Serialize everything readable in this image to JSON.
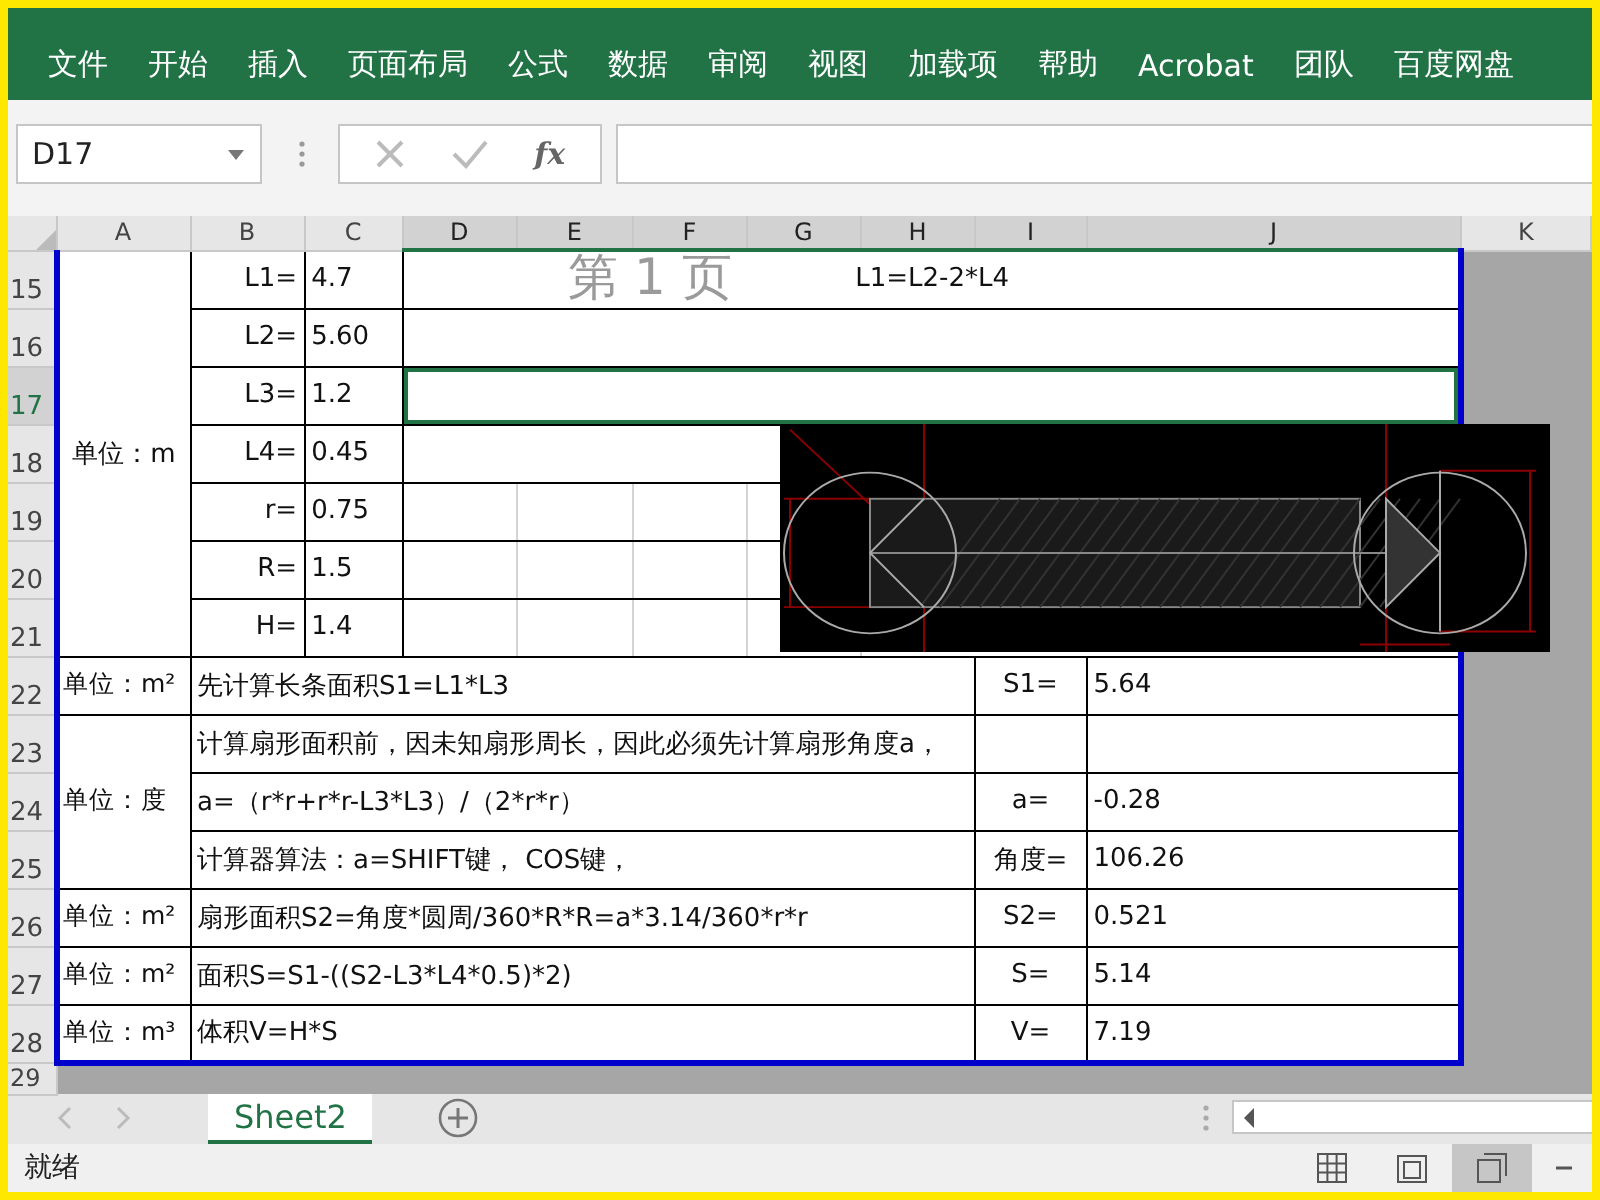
{
  "ribbon": {
    "tabs": [
      "文件",
      "开始",
      "插入",
      "页面布局",
      "公式",
      "数据",
      "审阅",
      "视图",
      "加载项",
      "帮助",
      "Acrobat",
      "团队",
      "百度网盘"
    ]
  },
  "formula_bar": {
    "name_box": "D17",
    "function_label": "fx"
  },
  "sheet": {
    "columns": [
      {
        "label": "A",
        "selected": false
      },
      {
        "label": "B",
        "selected": false
      },
      {
        "label": "C",
        "selected": false
      },
      {
        "label": "D",
        "selected": true
      },
      {
        "label": "E",
        "selected": true
      },
      {
        "label": "F",
        "selected": true
      },
      {
        "label": "G",
        "selected": true
      },
      {
        "label": "H",
        "selected": true
      },
      {
        "label": "I",
        "selected": true
      },
      {
        "label": "J",
        "selected": true
      },
      {
        "label": "K",
        "selected": false
      }
    ],
    "rows": [
      {
        "label": "15",
        "selected": false
      },
      {
        "label": "16",
        "selected": false
      },
      {
        "label": "17",
        "selected": true
      },
      {
        "label": "18",
        "selected": false
      },
      {
        "label": "19",
        "selected": false
      },
      {
        "label": "20",
        "selected": false
      },
      {
        "label": "21",
        "selected": false
      },
      {
        "label": "22",
        "selected": false
      },
      {
        "label": "23",
        "selected": false
      },
      {
        "label": "24",
        "selected": false
      },
      {
        "label": "25",
        "selected": false
      },
      {
        "label": "26",
        "selected": false
      },
      {
        "label": "27",
        "selected": false
      },
      {
        "label": "28",
        "selected": false
      },
      {
        "label": "29",
        "selected": false
      }
    ],
    "page_label": "第 1 页",
    "input_block": {
      "unit": "单位：m",
      "note": "L1=L2-2*L4",
      "params": [
        {
          "name": "L1=",
          "value": "4.7"
        },
        {
          "name": "L2=",
          "value": "5.60"
        },
        {
          "name": "L3=",
          "value": "1.2"
        },
        {
          "name": "L4=",
          "value": "0.45"
        },
        {
          "name": "r=",
          "value": "0.75"
        },
        {
          "name": "R=",
          "value": "1.5"
        },
        {
          "name": "H=",
          "value": "1.4"
        }
      ]
    },
    "calc_groups": [
      {
        "unit": "单位：m²",
        "lines": [
          {
            "text": "先计算长条面积S1=L1*L3",
            "label": "S1=",
            "value": "5.64"
          }
        ]
      },
      {
        "unit": "单位：度",
        "lines": [
          {
            "text": "计算扇形面积前，因未知扇形周长，因此必须先计算扇形角度a，"
          },
          {
            "text": "a=（r*r+r*r-L3*L3）/（2*r*r）",
            "label": "a=",
            "value": "-0.28"
          },
          {
            "text": "计算器算法：a=SHIFT键， COS键，",
            "label": "角度=",
            "value": "106.26"
          }
        ]
      },
      {
        "unit": "单位：m²",
        "lines": [
          {
            "text": "扇形面积S2=角度*圆周/360*R*R=a*3.14/360*r*r",
            "label": "S2=",
            "value": "0.521"
          }
        ]
      },
      {
        "unit": "单位：m²",
        "lines": [
          {
            "text": "面积S=S1-((S2-L3*L4*0.5)*2)",
            "label": "S=",
            "value": "5.14"
          }
        ]
      },
      {
        "unit": "单位：m³",
        "lines": [
          {
            "text": "体积V=H*S",
            "label": "V=",
            "value": "7.19"
          }
        ]
      }
    ]
  },
  "sheet_tabs": [
    {
      "label": "Sheet2",
      "selected": true
    }
  ],
  "status_bar": {
    "text": "就绪",
    "views": [
      {
        "kind": "normal",
        "selected": false
      },
      {
        "kind": "page_layout",
        "selected": false
      },
      {
        "kind": "page_break",
        "selected": true
      }
    ]
  }
}
